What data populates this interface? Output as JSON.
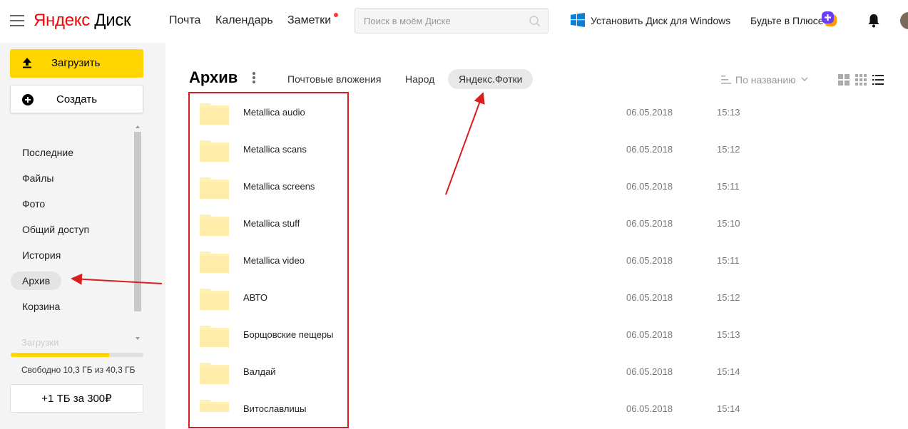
{
  "header": {
    "logo_brand": "Яндекс",
    "logo_product": "Диск",
    "nav": [
      "Почта",
      "Календарь",
      "Заметки"
    ],
    "search_placeholder": "Поиск в моём Диске",
    "install_windows": "Установить Диск для Windows",
    "plus_text": "Будьте в Плюсе"
  },
  "sidebar": {
    "upload_label": "Загрузить",
    "create_label": "Создать",
    "items": [
      "Последние",
      "Файлы",
      "Фото",
      "Общий доступ",
      "История",
      "Архив",
      "Корзина"
    ],
    "active_item": "Архив",
    "faded_item": "Загрузки",
    "quota_text": "Свободно 10,3 ГБ из 40,3 ГБ",
    "quota_used_fraction": 0.74,
    "buy_label": "+1 ТБ за 300₽"
  },
  "main": {
    "title": "Архив",
    "tabs": [
      "Почтовые вложения",
      "Народ",
      "Яндекс.Фотки"
    ],
    "active_tab": "Яндекс.Фотки",
    "sort_label": "По названию",
    "view_modes": [
      "large-grid-icon",
      "small-grid-icon",
      "list-icon"
    ],
    "active_view": "list-icon",
    "folders": [
      {
        "name": "Metallica audio",
        "date": "06.05.2018",
        "time": "15:13"
      },
      {
        "name": "Metallica scans",
        "date": "06.05.2018",
        "time": "15:12"
      },
      {
        "name": "Metallica screens",
        "date": "06.05.2018",
        "time": "15:11"
      },
      {
        "name": "Metallica stuff",
        "date": "06.05.2018",
        "time": "15:10"
      },
      {
        "name": "Metallica video",
        "date": "06.05.2018",
        "time": "15:11"
      },
      {
        "name": "АВТО",
        "date": "06.05.2018",
        "time": "15:12"
      },
      {
        "name": "Борщовские пещеры",
        "date": "06.05.2018",
        "time": "15:13"
      },
      {
        "name": "Валдай",
        "date": "06.05.2018",
        "time": "15:14"
      },
      {
        "name": "Витославлицы",
        "date": "06.05.2018",
        "time": "15:14"
      }
    ]
  },
  "colors": {
    "accent_yellow": "#ffd600",
    "folder_fill": "#fff0b3",
    "annotation_red": "#d81e1e"
  }
}
